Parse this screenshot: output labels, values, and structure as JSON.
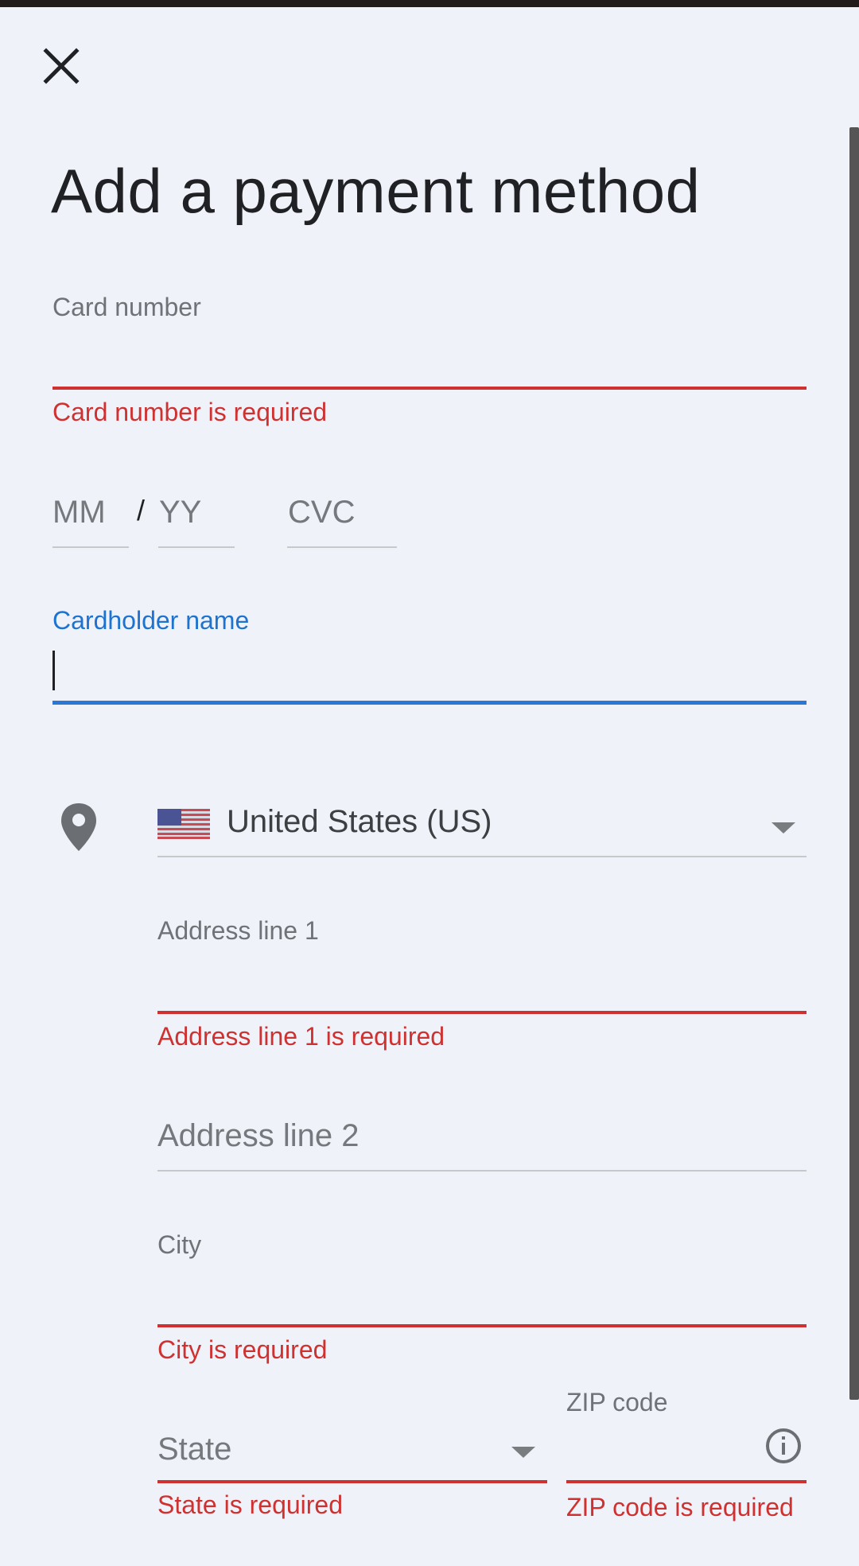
{
  "page": {
    "title": "Add a payment method"
  },
  "card": {
    "number_label": "Card number",
    "number_value": "",
    "number_error": "Card number is required",
    "month_placeholder": "MM",
    "date_separator": "/",
    "year_placeholder": "YY",
    "cvc_placeholder": "CVC",
    "cardholder_label": "Cardholder name",
    "cardholder_value": ""
  },
  "address": {
    "country": "United States (US)",
    "line1_label": "Address line 1",
    "line1_error": "Address line 1 is required",
    "line2_placeholder": "Address line 2",
    "city_label": "City",
    "city_error": "City is required",
    "state_placeholder": "State",
    "state_error": "State is required",
    "zip_label": "ZIP code",
    "zip_error": "ZIP code is required"
  },
  "icons": {
    "close": "close-icon",
    "location": "location-pin-icon",
    "flag": "us-flag-icon",
    "dropdown": "dropdown-arrow-icon",
    "info": "info-icon"
  },
  "colors": {
    "background": "#eff3f9",
    "error": "#cf3131",
    "focus": "#2b77d6",
    "text": "#202124",
    "muted": "#6f7377"
  }
}
